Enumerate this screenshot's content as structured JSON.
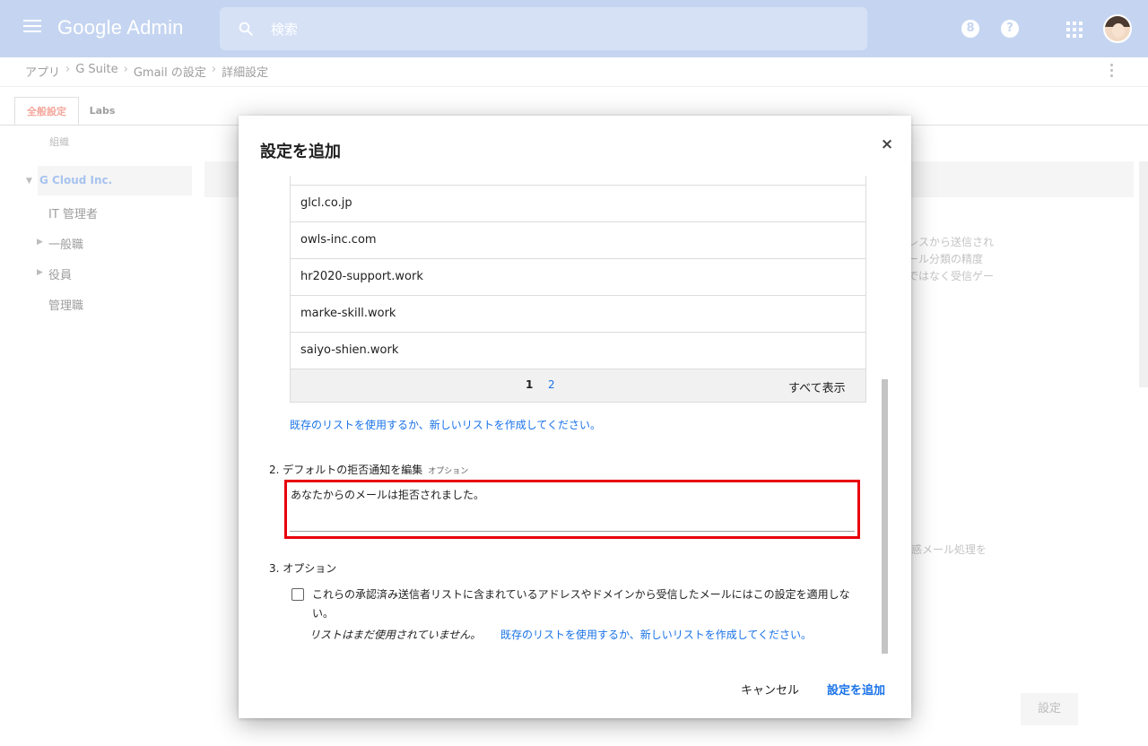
{
  "header": {
    "logo": "Google Admin",
    "search_placeholder": "検索",
    "support_icon_glyph": "8",
    "help_icon_glyph": "?"
  },
  "breadcrumb": [
    "アプリ",
    "G Suite",
    "Gmail の設定",
    "詳細設定"
  ],
  "breadcrumb_sep": "›",
  "tabs": [
    {
      "label": "全般設定",
      "active": true
    },
    {
      "label": "Labs",
      "active": false
    }
  ],
  "sidebar": {
    "org_label": "組織",
    "root": "G Cloud Inc.",
    "items": [
      {
        "label": "IT 管理者",
        "expandable": false
      },
      {
        "label": "一般職",
        "expandable": true
      },
      {
        "label": "役員",
        "expandable": true
      },
      {
        "label": "管理職",
        "expandable": false
      }
    ]
  },
  "background_page": {
    "right_text_lines": [
      "レスから送信され",
      "ール分類の精度",
      "ではなく受信ゲー"
    ],
    "right_text_2": "惑メール処理を",
    "settings_button": "設定"
  },
  "dialog": {
    "title": "設定を追加",
    "close_glyph": "×",
    "domains": [
      "glcl.co.jp",
      "owls-inc.com",
      "hr2020-support.work",
      "marke-skill.work",
      "saiyo-shien.work"
    ],
    "pager": {
      "page1": "1",
      "page2": "2",
      "show_all": "すべて表示"
    },
    "list_link": "既存のリストを使用するか、新しいリストを作成してください。",
    "section2": {
      "label": "2. デフォルトの拒否通知を編集",
      "optional": "オプション",
      "value": "あなたからのメールは拒否されました。"
    },
    "section3": {
      "label": "3. オプション",
      "checkbox_text": "これらの承認済み送信者リストに含まれているアドレスやドメインから受信したメールにはこの設定を適用しない。",
      "checked": false,
      "not_used": "リストはまだ使用されていません。",
      "list_link": "既存のリストを使用するか、新しいリストを作成してください。"
    },
    "cancel_label": "キャンセル",
    "add_label": "設定を追加"
  },
  "colors": {
    "topbar": "#c5d5f1",
    "link": "#1a73e8",
    "highlight_border": "#e8000b"
  }
}
